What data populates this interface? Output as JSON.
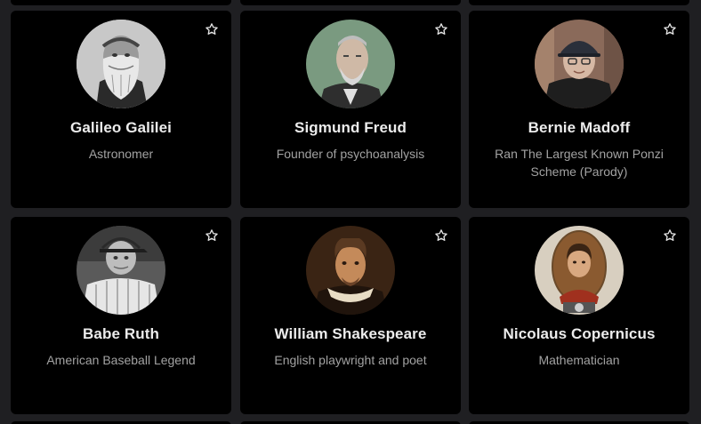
{
  "colors": {
    "page_background": "#1f1f22",
    "card_background": "#000000",
    "name_text": "#ececec",
    "description_text": "#a2a2a2",
    "star_outline": "#e6e6e6"
  },
  "cards": [
    {
      "name": "Galileo Galilei",
      "description": "Astronomer",
      "avatar_icon": "portrait-bearded-man-engraving-icon",
      "favorite_icon": "star-outline-icon"
    },
    {
      "name": "Sigmund Freud",
      "description": "Founder of psychoanalysis",
      "avatar_icon": "portrait-man-green-background-icon",
      "favorite_icon": "star-outline-icon"
    },
    {
      "name": "Bernie Madoff",
      "description": "Ran The Largest Known Ponzi Scheme (Parody)",
      "avatar_icon": "portrait-man-cap-icon",
      "favorite_icon": "star-outline-icon"
    },
    {
      "name": "Babe Ruth",
      "description": "American Baseball Legend",
      "avatar_icon": "portrait-baseball-player-icon",
      "favorite_icon": "star-outline-icon"
    },
    {
      "name": "William Shakespeare",
      "description": "English playwright and poet",
      "avatar_icon": "portrait-renaissance-painting-icon",
      "favorite_icon": "star-outline-icon"
    },
    {
      "name": "Nicolaus Copernicus",
      "description": "Mathematician",
      "avatar_icon": "portrait-oval-painting-icon",
      "favorite_icon": "star-outline-icon"
    }
  ]
}
